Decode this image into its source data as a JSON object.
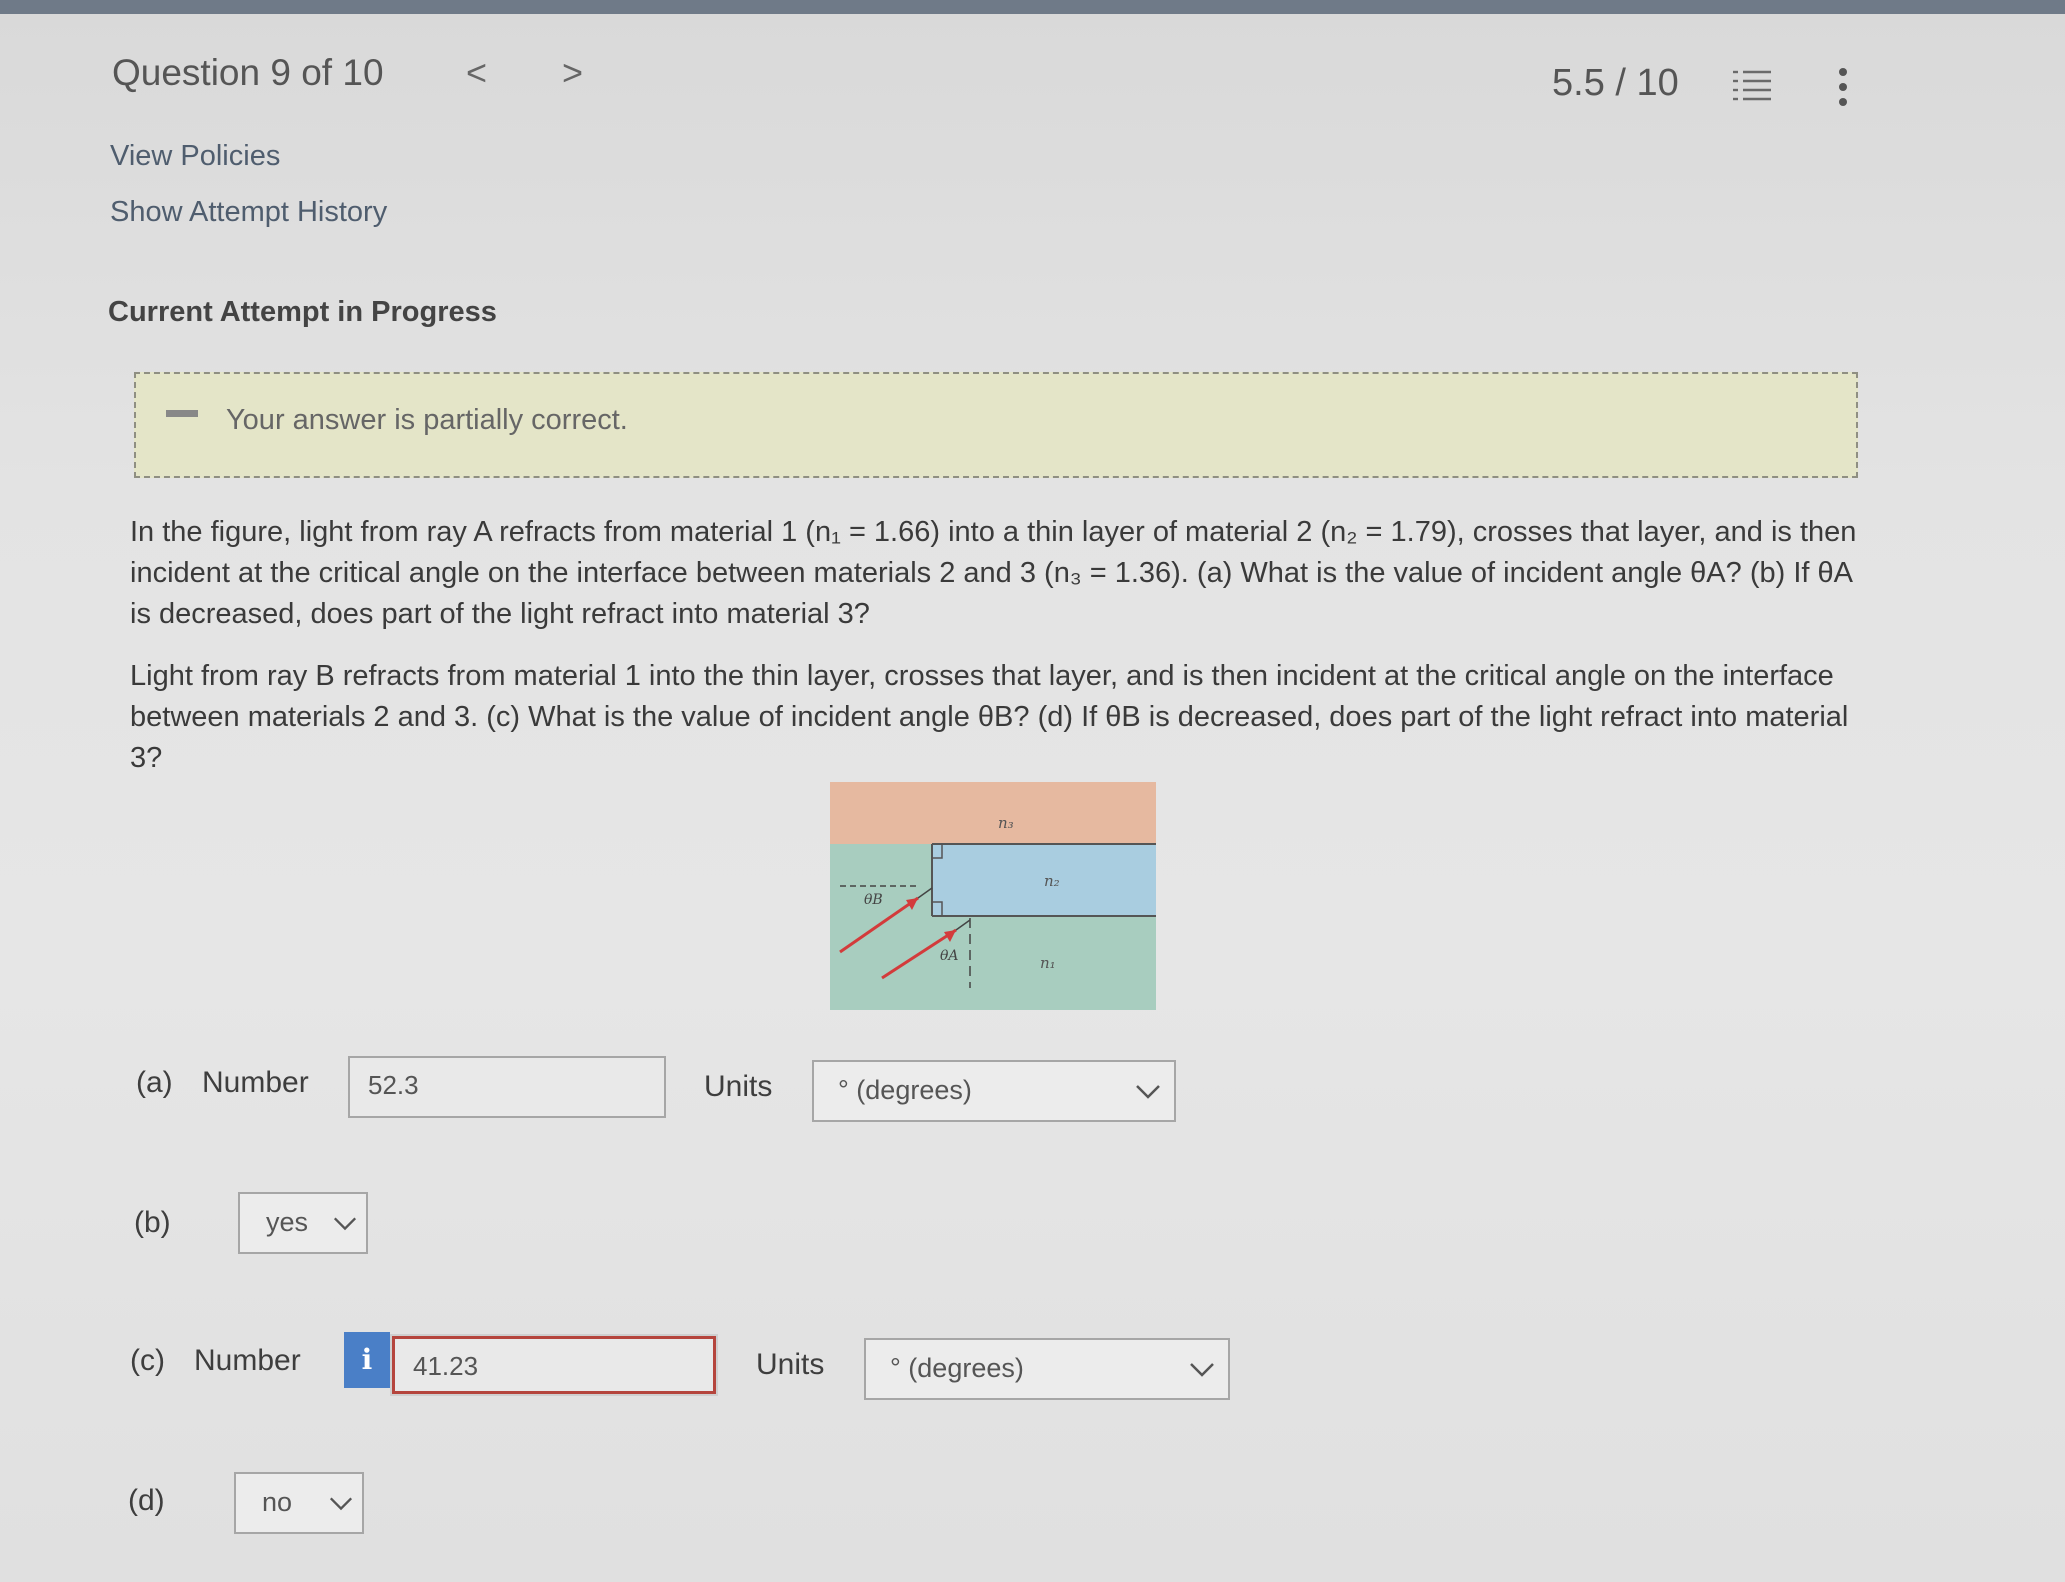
{
  "header": {
    "question_title": "Question 9 of 10",
    "prev_label": "<",
    "next_label": ">",
    "score": "5.5 / 10"
  },
  "links": {
    "view_policies": "View Policies",
    "show_attempt_history": "Show Attempt History"
  },
  "attempt_status": "Current Attempt in Progress",
  "feedback": "Your answer is partially correct.",
  "question": {
    "para1": "In the figure, light from ray A refracts from material 1 (n₁ = 1.66) into a thin layer of material 2 (n₂ = 1.79), crosses that layer, and is then incident at the critical angle on the interface between materials 2 and 3 (n₃ = 1.36). (a) What is the value of incident angle θA? (b) If θA is decreased, does part of the light refract into material 3?",
    "para2": "Light from ray B refracts from material 1 into the thin layer, crosses that layer, and is then incident at the critical angle on the interface between materials 2 and 3. (c) What is the value of incident angle θB? (d) If θB is decreased, does part of the light refract into material 3?"
  },
  "figure": {
    "n3": "n₃",
    "n2": "n₂",
    "n1": "n₁",
    "thetaB": "θB",
    "thetaA": "θA",
    "colors": {
      "material3": "#e6b9a0",
      "material2": "#a9cde0",
      "material1": "#a8cdbf",
      "ray": "#d33b3b"
    }
  },
  "answers": {
    "a": {
      "label": "(a)",
      "type_label": "Number",
      "value": "52.3",
      "units_label": "Units",
      "units": "° (degrees)"
    },
    "b": {
      "label": "(b)",
      "value": "yes"
    },
    "c": {
      "label": "(c)",
      "type_label": "Number",
      "info_icon": "i",
      "value": "41.23",
      "units_label": "Units",
      "units": "° (degrees)"
    },
    "d": {
      "label": "(d)",
      "value": "no"
    }
  }
}
